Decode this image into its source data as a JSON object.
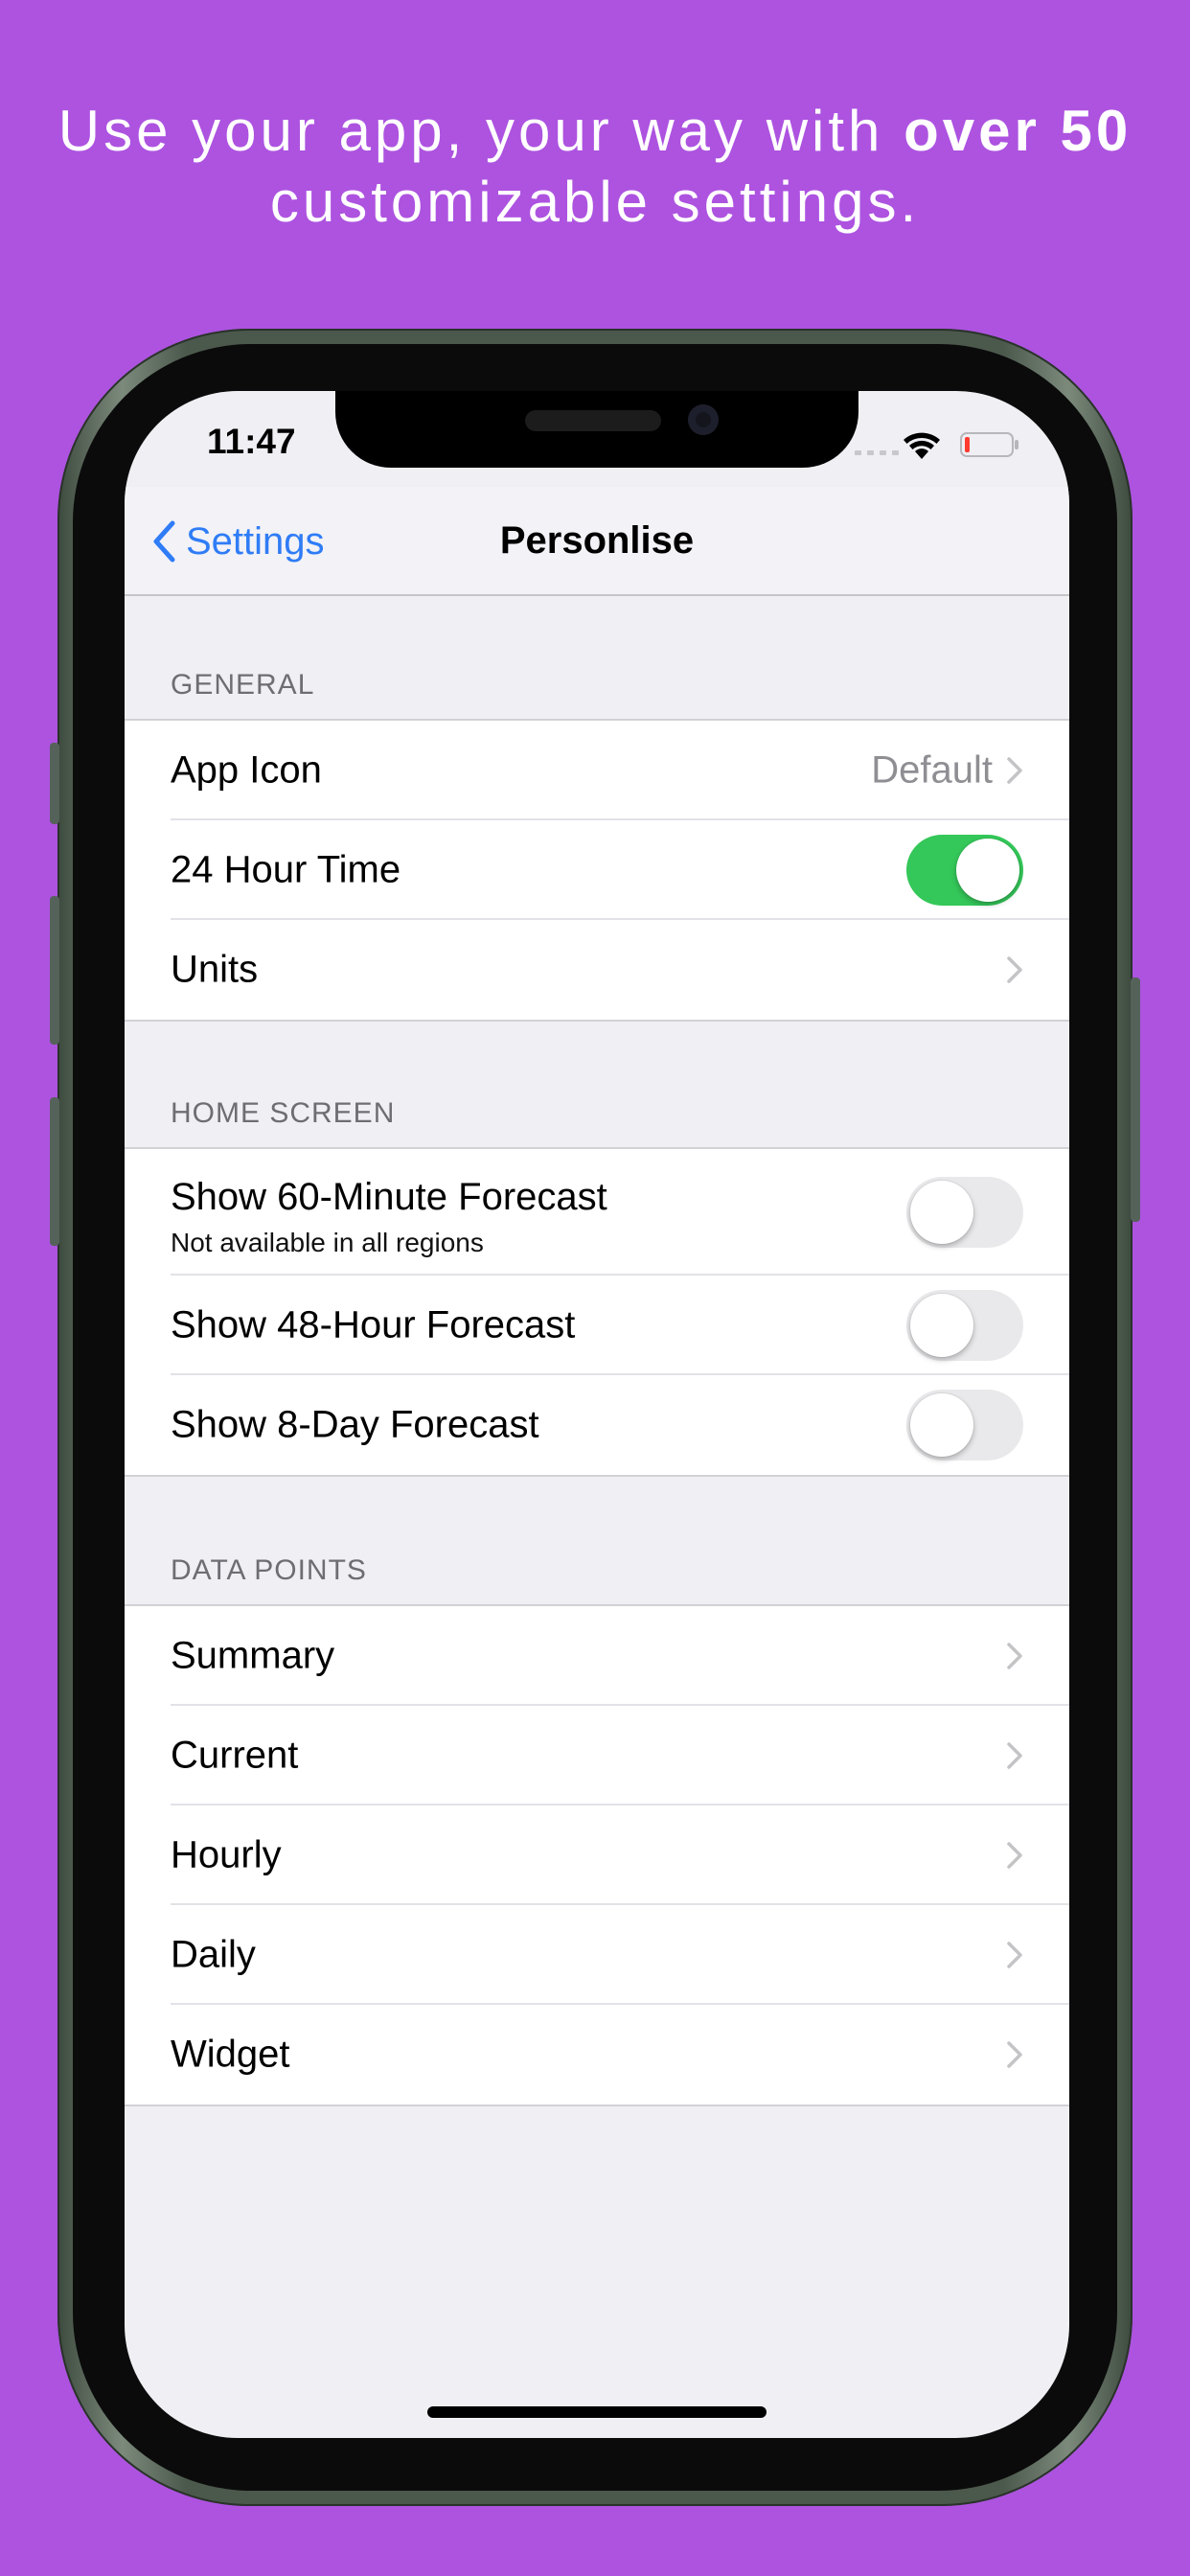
{
  "caption": {
    "prefix": "Use your app, your way with ",
    "bold": "over 50",
    "suffix": "customizable settings."
  },
  "status_bar": {
    "time": "11:47"
  },
  "navbar": {
    "back_label": "Settings",
    "title": "Personlise"
  },
  "colors": {
    "background": "#ad53e0",
    "accent": "#2f7cf6",
    "toggle_on": "#34c759"
  },
  "sections": {
    "general": {
      "header": "GENERAL",
      "app_icon": {
        "label": "App Icon",
        "value": "Default"
      },
      "hour_time": {
        "label": "24 Hour Time",
        "toggle": true
      },
      "units": {
        "label": "Units"
      }
    },
    "home_screen": {
      "header": "HOME SCREEN",
      "minute_forecast": {
        "label": "Show 60-Minute Forecast",
        "sublabel": "Not available in all regions",
        "toggle": false
      },
      "hour_forecast": {
        "label": "Show 48-Hour Forecast",
        "toggle": false
      },
      "day_forecast": {
        "label": "Show 8-Day Forecast",
        "toggle": false
      }
    },
    "data_points": {
      "header": "DATA POINTS",
      "items": [
        "Summary",
        "Current",
        "Hourly",
        "Daily",
        "Widget"
      ]
    }
  }
}
